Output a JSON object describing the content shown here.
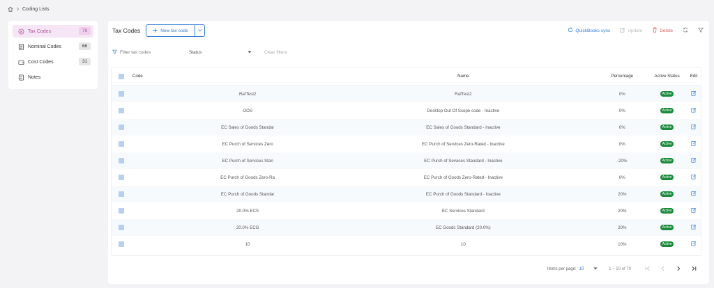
{
  "breadcrumb": {
    "home_icon": "home-icon",
    "current": "Coding Lists"
  },
  "sidebar": {
    "items": [
      {
        "label": "Tax Codes",
        "count": "79",
        "icon": "circle-x-icon",
        "active": true
      },
      {
        "label": "Nominal Codes",
        "count": "66",
        "icon": "document-icon",
        "active": false
      },
      {
        "label": "Cost Codes",
        "count": "31",
        "icon": "wallet-icon",
        "active": false
      },
      {
        "label": "Notes",
        "count": "",
        "icon": "note-icon",
        "active": false
      }
    ]
  },
  "toolbar": {
    "title": "Tax Codes",
    "new_label": "New tax code",
    "qb_label": "QuickBooks sync",
    "update_label": "Update",
    "delete_label": "Delete"
  },
  "filters": {
    "filter_label": "Filter tax codes",
    "status_label": "Status",
    "clear_label": "Clear filters"
  },
  "table": {
    "headers": {
      "code": "Code",
      "name": "Name",
      "percentage": "Percentage",
      "status": "Active Status",
      "edit": "Edit"
    },
    "rows": [
      {
        "code": "RafTest2",
        "name": "RafTest2",
        "percentage": "0%",
        "status": "Active"
      },
      {
        "code": "OOS",
        "name": "Desktop Out Of Scope code - Inactive",
        "percentage": "0%",
        "status": "Active"
      },
      {
        "code": "EC Sales of Goods Standar",
        "name": "EC Sales of Goods Standard - Inactive",
        "percentage": "0%",
        "status": "Active"
      },
      {
        "code": "EC Purch of Services Zero",
        "name": "EC Purch of Services Zero-Rated - Inactive",
        "percentage": "0%",
        "status": "Active"
      },
      {
        "code": "EC Purch of Services Stan",
        "name": "EC Purch of Services Standard - Inactive",
        "percentage": "-20%",
        "status": "Active"
      },
      {
        "code": "EC Purch of Goods Zero-Ra",
        "name": "EC Purch of Goods Zero-Rated - Inactive",
        "percentage": "0%",
        "status": "Active"
      },
      {
        "code": "EC Purch of Goods Standar",
        "name": "EC Purch of Goods Standard - Inactive",
        "percentage": "20%",
        "status": "Active"
      },
      {
        "code": "20.0% ECS",
        "name": "EC Services Standard",
        "percentage": "20%",
        "status": "Active"
      },
      {
        "code": "20.0% ECG",
        "name": "EC Goods Standard (20.0%)",
        "percentage": "20%",
        "status": "Active"
      },
      {
        "code": "10",
        "name": "10",
        "percentage": "10%",
        "status": "Active"
      }
    ]
  },
  "pagination": {
    "items_per_page_label": "Items per page:",
    "items_per_page_value": "10",
    "range": "1 – 10 of 79"
  },
  "colors": {
    "accent": "#2f7bd6",
    "active_badge": "#1b8a3a",
    "delete": "#e05a5a",
    "sidebar_active": "#b0529f"
  }
}
